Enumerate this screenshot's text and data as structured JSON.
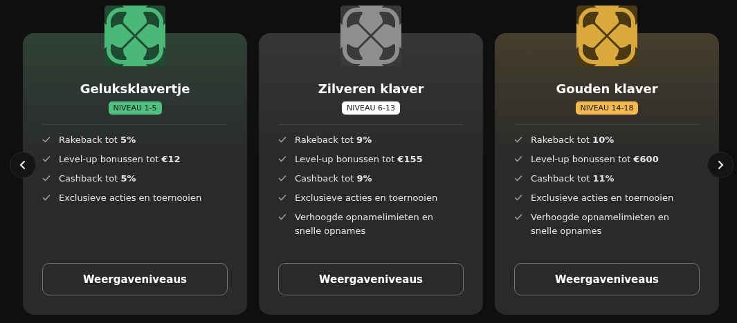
{
  "tiers": [
    {
      "kind": "green",
      "title": "Geluksklavertje",
      "badge": {
        "label": "NIVEAU 1-5",
        "color": "#4ec07f"
      },
      "features": [
        "Rakeback tot **5%**",
        "Level-up bonussen tot **€12**",
        "Cashback tot **5%**",
        "Exclusieve acties en toernooien"
      ],
      "button": "Weergaveniveaus"
    },
    {
      "kind": "silver",
      "title": "Zilveren klaver",
      "badge": {
        "label": "NIVEAU 6-13",
        "color": "#ffffff"
      },
      "features": [
        "Rakeback tot **9%**",
        "Level-up bonussen tot **€155**",
        "Cashback tot **9%**",
        "Exclusieve acties en toernooien",
        "Verhoogde opnamelimieten en snelle opnames"
      ],
      "button": "Weergaveniveaus"
    },
    {
      "kind": "gold",
      "title": "Gouden klaver",
      "badge": {
        "label": "NIVEAU 14-18",
        "color": "#f4b94c"
      },
      "features": [
        "Rakeback tot **10%**",
        "Level-up bonussen tot **€600**",
        "Cashback tot **11%**",
        "Exclusieve acties en toernooien",
        "Verhoogde opnamelimieten en snelle opnames"
      ],
      "button": "Weergaveniveaus"
    }
  ]
}
